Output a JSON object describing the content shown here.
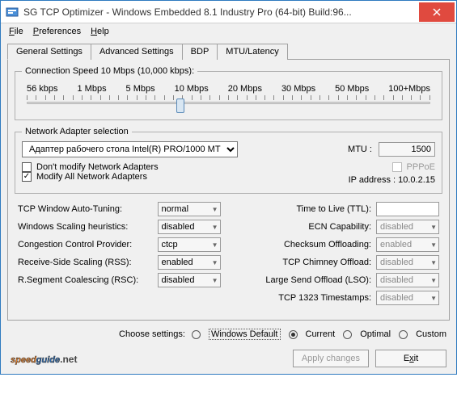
{
  "title": "SG TCP Optimizer - Windows Embedded 8.1 Industry Pro (64-bit) Build:96...",
  "menu": {
    "file": "File",
    "preferences": "Preferences",
    "help": "Help"
  },
  "tabs": {
    "general": "General Settings",
    "advanced": "Advanced Settings",
    "bdp": "BDP",
    "mtu": "MTU/Latency"
  },
  "connspeed": {
    "legend": "Connection Speed  10 Mbps (10,000 kbps):",
    "labels": [
      "56 kbps",
      "1 Mbps",
      "5 Mbps",
      "10 Mbps",
      "20 Mbps",
      "30 Mbps",
      "50 Mbps",
      "100+Mbps"
    ]
  },
  "adapter": {
    "legend": "Network Adapter selection",
    "selected": "Адаптер рабочего стола Intel(R) PRO/1000 MT",
    "dont_modify": "Don't modify Network Adapters",
    "modify_all": "Modify All Network Adapters",
    "mtu_label": "MTU :",
    "mtu_value": "1500",
    "pppoe": "PPPoE",
    "ip_label": "IP address : 10.0.2.15"
  },
  "left": {
    "autotune_l": "TCP Window Auto-Tuning:",
    "autotune_v": "normal",
    "scale_l": "Windows Scaling heuristics:",
    "scale_v": "disabled",
    "cong_l": "Congestion Control Provider:",
    "cong_v": "ctcp",
    "rss_l": "Receive-Side Scaling (RSS):",
    "rss_v": "enabled",
    "rsc_l": "R.Segment Coalescing (RSC):",
    "rsc_v": "disabled"
  },
  "right": {
    "ttl_l": "Time to Live (TTL):",
    "ttl_v": "",
    "ecn_l": "ECN Capability:",
    "ecn_v": "disabled",
    "csum_l": "Checksum Offloading:",
    "csum_v": "enabled",
    "chim_l": "TCP Chimney Offload:",
    "chim_v": "disabled",
    "lso_l": "Large Send Offload (LSO):",
    "lso_v": "disabled",
    "ts_l": "TCP 1323 Timestamps:",
    "ts_v": "disabled"
  },
  "choose": {
    "label": "Choose settings:",
    "windef": "Windows Default",
    "current": "Current",
    "optimal": "Optimal",
    "custom": "Custom"
  },
  "buttons": {
    "apply": "Apply changes",
    "exit": "Exit"
  },
  "logo": {
    "a": "speed",
    "b": "guide",
    "c": ".net"
  }
}
